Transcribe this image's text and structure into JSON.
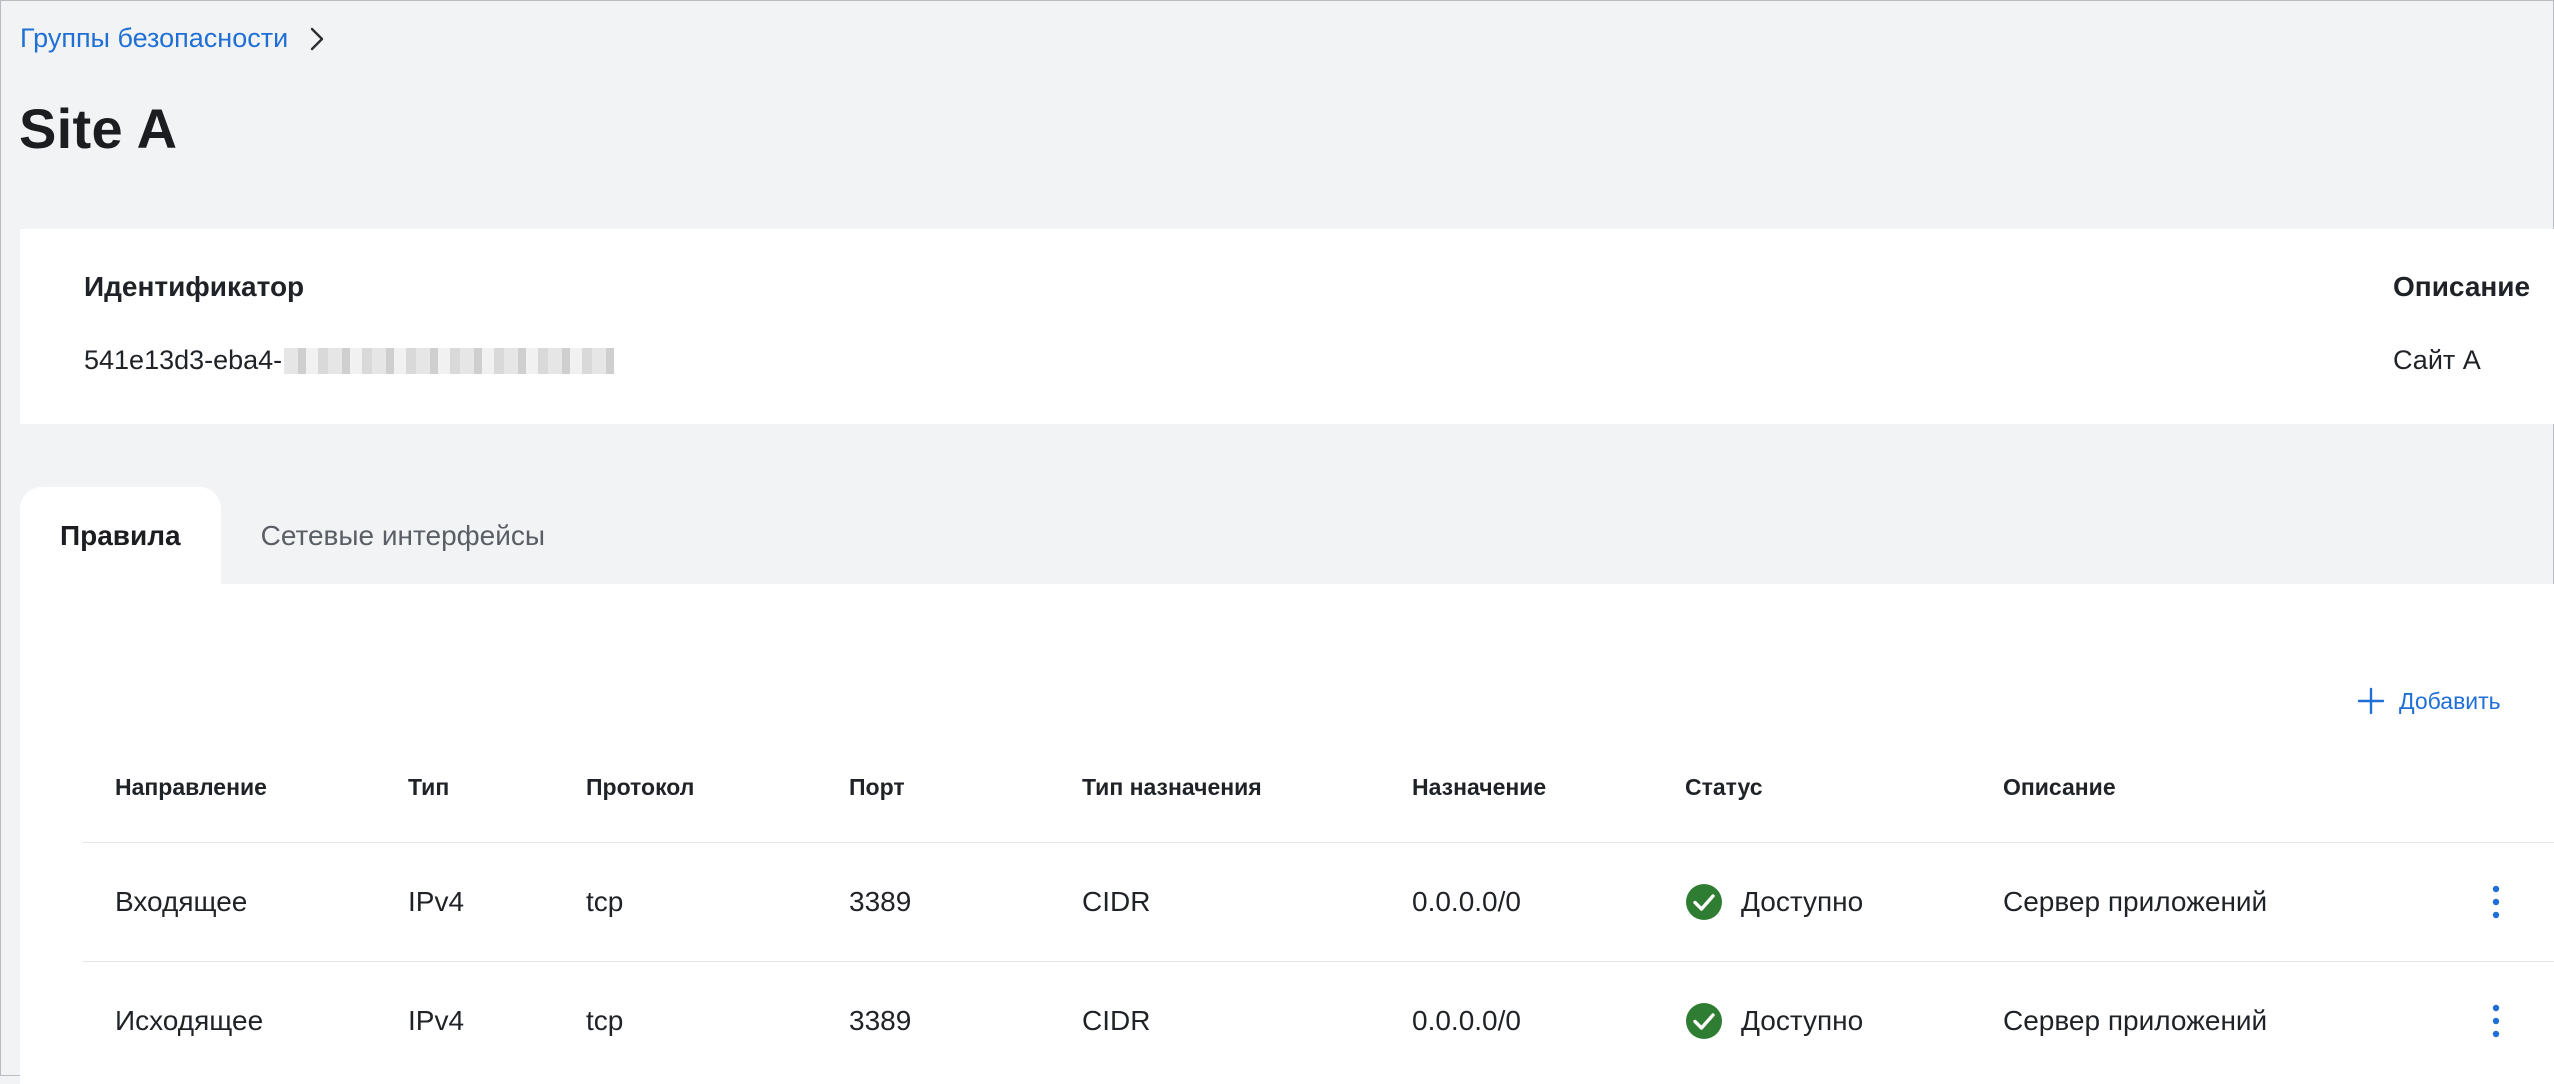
{
  "breadcrumb": {
    "parent": "Группы безопасности"
  },
  "page_title": "Site A",
  "info": {
    "id_label": "Идентификатор",
    "id_value": "541e13d3-eba4-",
    "desc_label": "Описание",
    "desc_value": "Сайт A"
  },
  "tabs": [
    {
      "label": "Правила",
      "active": true
    },
    {
      "label": "Сетевые интерфейсы",
      "active": false
    }
  ],
  "add_label": "Добавить",
  "columns": [
    "Направление",
    "Тип",
    "Протокол",
    "Порт",
    "Тип назначения",
    "Назначение",
    "Статус",
    "Описание"
  ],
  "rows": [
    {
      "direction": "Входящее",
      "type": "IPv4",
      "protocol": "tcp",
      "port": "3389",
      "dest_type": "CIDR",
      "dest": "0.0.0.0/0",
      "status": "Доступно",
      "description": "Сервер приложений"
    },
    {
      "direction": "Исходящее",
      "type": "IPv4",
      "protocol": "tcp",
      "port": "3389",
      "dest_type": "CIDR",
      "dest": "0.0.0.0/0",
      "status": "Доступно",
      "description": "Сервер приложений"
    }
  ],
  "colors": {
    "accent": "#1f6fd6",
    "status_ok": "#2e7d32"
  }
}
